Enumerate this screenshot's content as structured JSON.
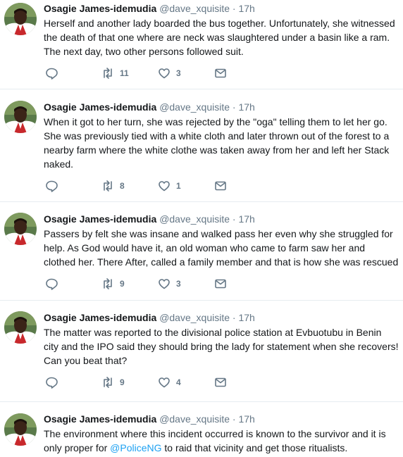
{
  "tweets": [
    {
      "author_name": "Osagie James-idemudia",
      "handle": "@dave_xquisite",
      "separator": "·",
      "time": "17h",
      "text": "Herself and another lady boarded the bus together. Unfortunately, she witnessed the death of that one where are neck was slaughtered under a basin like a ram. The next day, two other persons followed suit.",
      "retweets": "11",
      "likes": "3"
    },
    {
      "author_name": "Osagie James-idemudia",
      "handle": "@dave_xquisite",
      "separator": "·",
      "time": "17h",
      "text": "When it got to her turn, she was rejected by the \"oga\" telling them to let her go. She was previously tied with a white cloth and later thrown out of the forest to a nearby farm where the white clothe was taken away from her and left her Stack naked.",
      "retweets": "8",
      "likes": "1"
    },
    {
      "author_name": "Osagie James-idemudia",
      "handle": "@dave_xquisite",
      "separator": "·",
      "time": "17h",
      "text": "Passers by felt she was insane and walked pass her even why she struggled for help. As God would have it,  an old woman who came to farm saw her and clothed her. There After, called a family member and that is how she was rescued",
      "retweets": "9",
      "likes": "3"
    },
    {
      "author_name": "Osagie James-idemudia",
      "handle": "@dave_xquisite",
      "separator": "·",
      "time": "17h",
      "text": "The matter was reported to the divisional police station at Evbuotubu in Benin city and the IPO said they should bring the lady for statement when she recovers! Can you beat that?",
      "retweets": "9",
      "likes": "4"
    },
    {
      "author_name": "Osagie James-idemudia",
      "handle": "@dave_xquisite",
      "separator": "·",
      "time": "17h",
      "text_before": "The environment where this incident occurred is known to the survivor and it is only proper for ",
      "mention": "@PoliceNG",
      "text_after": " to raid that vicinity and get those ritualists."
    }
  ],
  "icons": {
    "reply": "reply-icon",
    "retweet": "retweet-icon",
    "like": "heart-icon",
    "message": "direct-message-icon",
    "avatar": "profile-photo"
  },
  "colors": {
    "text": "#14171a",
    "secondary": "#657786",
    "link": "#1da1f2",
    "divider": "#e6ecf0"
  }
}
